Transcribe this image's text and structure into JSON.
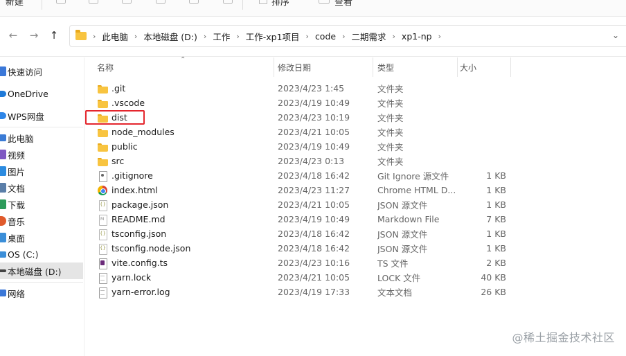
{
  "toolbar": {
    "new_label": "新建",
    "sort_label": "排序",
    "view_label": "查看"
  },
  "nav": {
    "back_glyph": "←",
    "forward_glyph": "→",
    "up_glyph": "↑",
    "dropdown_glyph": "⌄"
  },
  "breadcrumb": [
    "此电脑",
    "本地磁盘 (D:)",
    "工作",
    "工作-xp1项目",
    "code",
    "二期需求",
    "xp1-np"
  ],
  "sidebar": {
    "items": [
      {
        "label": "快速访问",
        "icon": "star-icon",
        "color": "#3b78d8"
      },
      {
        "label": "OneDrive",
        "icon": "cloud-icon",
        "color": "#1f7ad8"
      },
      {
        "label": "WPS网盘",
        "icon": "cloud-icon",
        "color": "#2e86e8"
      },
      {
        "label": "此电脑",
        "icon": "computer-icon",
        "color": "#3a7bd5"
      },
      {
        "label": "视频",
        "icon": "video-icon",
        "color": "#7e57c2"
      },
      {
        "label": "图片",
        "icon": "image-icon",
        "color": "#2b8be0"
      },
      {
        "label": "文档",
        "icon": "document-icon",
        "color": "#5a7ea8"
      },
      {
        "label": "下载",
        "icon": "download-icon",
        "color": "#2c9a5a"
      },
      {
        "label": "音乐",
        "icon": "music-icon",
        "color": "#e05a2b"
      },
      {
        "label": "桌面",
        "icon": "desktop-icon",
        "color": "#3b8ed8"
      },
      {
        "label": "OS (C:)",
        "icon": "drive-icon",
        "color": "#3b8ed8"
      },
      {
        "label": "本地磁盘 (D:)",
        "icon": "drive-icon",
        "color": "#444444"
      },
      {
        "label": "网络",
        "icon": "network-icon",
        "color": "#3b78d8"
      }
    ],
    "selected_index": 11
  },
  "columns": {
    "name": "名称",
    "date": "修改日期",
    "type": "类型",
    "size": "大小"
  },
  "files": [
    {
      "name": ".git",
      "date": "2023/4/23 1:45",
      "type": "文件夹",
      "size": "",
      "icon": "folder-icon"
    },
    {
      "name": ".vscode",
      "date": "2023/4/19 10:49",
      "type": "文件夹",
      "size": "",
      "icon": "folder-icon"
    },
    {
      "name": "dist",
      "date": "2023/4/23 10:19",
      "type": "文件夹",
      "size": "",
      "icon": "folder-icon"
    },
    {
      "name": "node_modules",
      "date": "2023/4/21 10:05",
      "type": "文件夹",
      "size": "",
      "icon": "folder-icon"
    },
    {
      "name": "public",
      "date": "2023/4/19 10:49",
      "type": "文件夹",
      "size": "",
      "icon": "folder-icon"
    },
    {
      "name": "src",
      "date": "2023/4/23 0:13",
      "type": "文件夹",
      "size": "",
      "icon": "folder-icon"
    },
    {
      "name": ".gitignore",
      "date": "2023/4/18 16:42",
      "type": "Git Ignore 源文件",
      "size": "1 KB",
      "icon": "git-file-icon"
    },
    {
      "name": "index.html",
      "date": "2023/4/23 11:27",
      "type": "Chrome HTML D...",
      "size": "1 KB",
      "icon": "chrome-icon"
    },
    {
      "name": "package.json",
      "date": "2023/4/21 10:05",
      "type": "JSON 源文件",
      "size": "1 KB",
      "icon": "json-file-icon"
    },
    {
      "name": "README.md",
      "date": "2023/4/19 10:49",
      "type": "Markdown File",
      "size": "7 KB",
      "icon": "markdown-file-icon"
    },
    {
      "name": "tsconfig.json",
      "date": "2023/4/18 16:42",
      "type": "JSON 源文件",
      "size": "1 KB",
      "icon": "json-file-icon"
    },
    {
      "name": "tsconfig.node.json",
      "date": "2023/4/18 16:42",
      "type": "JSON 源文件",
      "size": "1 KB",
      "icon": "json-file-icon"
    },
    {
      "name": "vite.config.ts",
      "date": "2023/4/23 10:16",
      "type": "TS 文件",
      "size": "2 KB",
      "icon": "ts-file-icon"
    },
    {
      "name": "yarn.lock",
      "date": "2023/4/21 10:05",
      "type": "LOCK 文件",
      "size": "40 KB",
      "icon": "document-icon"
    },
    {
      "name": "yarn-error.log",
      "date": "2023/4/19 17:33",
      "type": "文本文档",
      "size": "26 KB",
      "icon": "text-file-icon"
    }
  ],
  "highlight_color": "#e4262d",
  "watermark": "@稀土掘金技术社区"
}
